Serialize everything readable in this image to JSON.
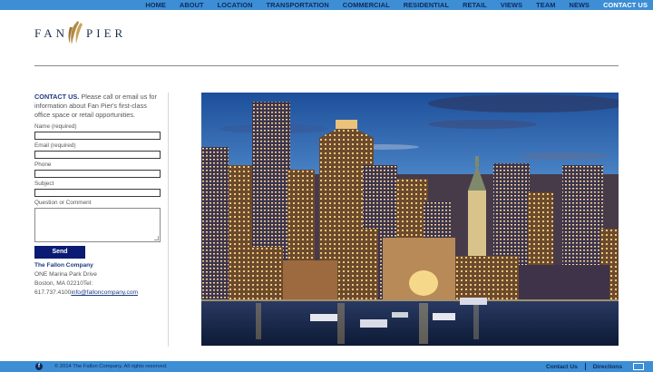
{
  "nav": {
    "items": [
      "HOME",
      "ABOUT",
      "LOCATION",
      "TRANSPORTATION",
      "COMMERCIAL",
      "RESIDENTIAL",
      "RETAIL",
      "VIEWS",
      "TEAM",
      "NEWS",
      "CONTACT US"
    ],
    "active": "CONTACT US"
  },
  "logo": {
    "left": "FAN",
    "right": "PIER"
  },
  "contact": {
    "title": "CONTACT US.",
    "intro": " Please call or email us for information about Fan Pier's first-class office space or retail opportunities."
  },
  "form": {
    "name_label": "Name (required)",
    "email_label": "Email (required)",
    "phone_label": "Phone",
    "subject_label": "Subject",
    "question_label": "Question or Comment",
    "send_label": "Send"
  },
  "company": {
    "name": "The Fallon Company",
    "address_line1": "ONE Marina Park Drive",
    "address_line2": "Boston, MA 02210Tel:",
    "phone": "617.737.4100",
    "email": "info@falloncompany.com"
  },
  "footer": {
    "facebook": "f",
    "copyright": "© 2014 The Fallon Company. All rights reserved.",
    "contact_link": "Contact Us",
    "directions_link": "Directions"
  },
  "colors": {
    "nav_bg": "#3d8ed5",
    "nav_text": "#0e2a5c",
    "accent": "#1e3b82",
    "button": "#0b1a72"
  }
}
